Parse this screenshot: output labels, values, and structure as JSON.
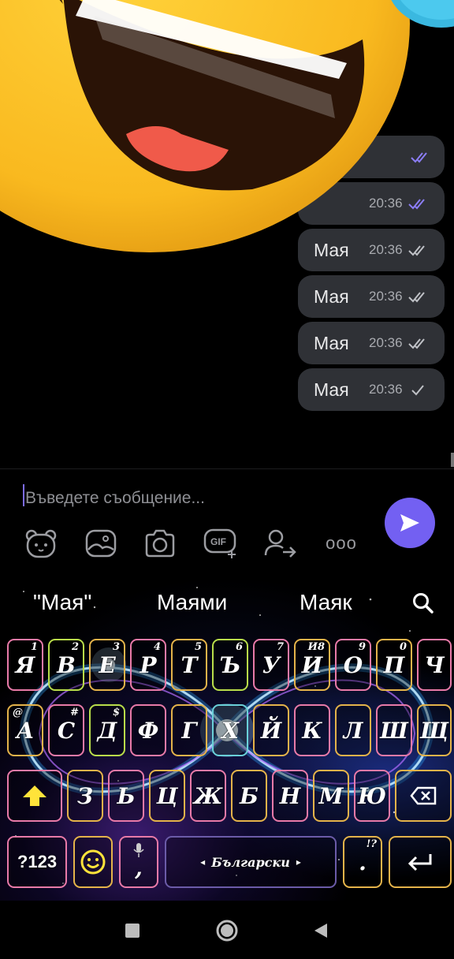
{
  "chat": {
    "messages": [
      {
        "text": "",
        "time": "",
        "status": "read"
      },
      {
        "text": "",
        "time": "20:36",
        "status": "read"
      },
      {
        "text": "Мая",
        "time": "20:36",
        "status": "delivered"
      },
      {
        "text": "Мая",
        "time": "20:36",
        "status": "delivered"
      },
      {
        "text": "Мая",
        "time": "20:36",
        "status": "delivered"
      },
      {
        "text": "Мая",
        "time": "20:36",
        "status": "sent"
      }
    ]
  },
  "composer": {
    "placeholder": "Въведете съобщение...",
    "value": "",
    "tools": [
      "sticker-icon",
      "gallery-icon",
      "camera-icon",
      "gif-icon",
      "share-contact-icon",
      "more-icon"
    ],
    "gif_label": "GIF",
    "more_label": "ooo",
    "send_color": "#7360f2"
  },
  "keyboard": {
    "suggestions": [
      "\"Мая\"",
      "Маями",
      "Маяк"
    ],
    "row1": [
      {
        "key": "Я",
        "alt": "1"
      },
      {
        "key": "В",
        "alt": "2"
      },
      {
        "key": "Е",
        "alt": "3"
      },
      {
        "key": "Р",
        "alt": "4"
      },
      {
        "key": "Т",
        "alt": "5"
      },
      {
        "key": "Ъ",
        "alt": "6"
      },
      {
        "key": "У",
        "alt": "7"
      },
      {
        "key": "И",
        "alt": "И8"
      },
      {
        "key": "О",
        "alt": "9"
      },
      {
        "key": "П",
        "alt": "0"
      },
      {
        "key": "Ч",
        "alt": ""
      }
    ],
    "row2": [
      {
        "key": "А",
        "alt": "@"
      },
      {
        "key": "С",
        "alt": "#"
      },
      {
        "key": "Д",
        "alt": "$"
      },
      {
        "key": "Ф",
        "alt": ""
      },
      {
        "key": "Г",
        "alt": ""
      },
      {
        "key": "Х",
        "alt": ""
      },
      {
        "key": "Й",
        "alt": ""
      },
      {
        "key": "К",
        "alt": ""
      },
      {
        "key": "Л",
        "alt": ""
      },
      {
        "key": "Ш",
        "alt": ""
      },
      {
        "key": "Щ",
        "alt": ""
      }
    ],
    "row3": [
      {
        "key": "З"
      },
      {
        "key": "Ь"
      },
      {
        "key": "Ц"
      },
      {
        "key": "Ж"
      },
      {
        "key": "Б"
      },
      {
        "key": "Н"
      },
      {
        "key": "М"
      },
      {
        "key": "Ю"
      }
    ],
    "symbols_label": "?123",
    "comma_label": ",",
    "period_label": ".",
    "period_alt": "!?",
    "space_label": "Български",
    "space_left_arrow": "◂",
    "space_right_arrow": "▸"
  },
  "navbar": {
    "items": [
      "recents-icon",
      "home-icon",
      "back-icon"
    ]
  }
}
